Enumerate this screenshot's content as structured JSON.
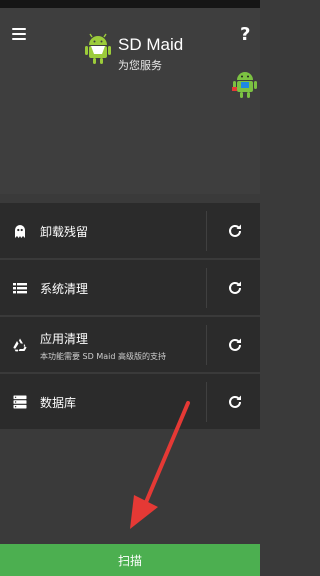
{
  "app": {
    "title": "SD Maid",
    "subtitle": "为您服务",
    "help_label": "?"
  },
  "tools": [
    {
      "label": "卸载残留",
      "icon": "ghost-icon"
    },
    {
      "label": "系统清理",
      "icon": "list-icon"
    },
    {
      "label": "应用清理",
      "sublabel": "本功能需要 SD Maid 高级版的支持",
      "icon": "recycle-icon"
    },
    {
      "label": "数据库",
      "icon": "database-icon"
    }
  ],
  "action": {
    "scan_label": "扫描"
  },
  "colors": {
    "accent": "#4caf50",
    "annotation_arrow": "#e53935",
    "row_bg": "#2b2b2b",
    "header_bg": "#3e3e3e"
  }
}
